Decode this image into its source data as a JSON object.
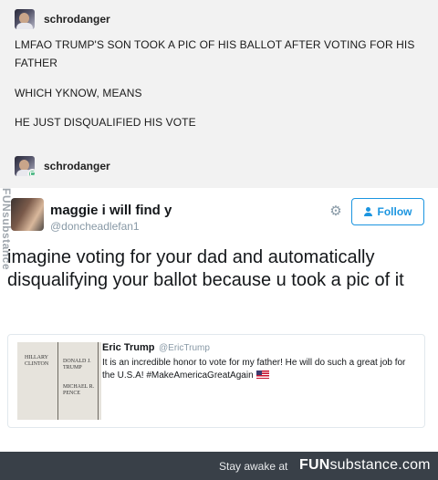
{
  "post": {
    "author": "schrodanger",
    "lines": [
      "LMFAO TRUMP'S SON TOOK A PIC OF HIS BALLOT AFTER VOTING FOR HIS",
      "FATHER",
      "WHICH YKNOW, MEANS",
      "HE JUST DISQUALIFIED HIS VOTE"
    ],
    "reblogger": "schrodanger"
  },
  "watermark": "FUNsubstance",
  "tweet": {
    "name": "maggie i will find y",
    "handle": "@doncheadlefan1",
    "settings_icon": "gear-icon",
    "follow_label": "Follow",
    "text": "imagine voting for your dad and automatically disqualifying your ballot because u took a pic of it",
    "quoted": {
      "name": "Eric Trump",
      "handle": "@EricTrump",
      "text": "It is an incredible honor to vote for my father! He will do such a great job for the U.S.A! #MakeAmericaGreatAgain",
      "thumbnail_labels": [
        "HILLARY",
        "CLINTON",
        "DONALD J.",
        "TRUMP",
        "MICHAEL R.",
        "PENCE"
      ]
    }
  },
  "footer": {
    "tagline": "Stay awake at",
    "brand_bold": "FUN",
    "brand_rest": "substance",
    "brand_suffix": ".com"
  },
  "colors": {
    "tumblr_bg": "#f2f2f2",
    "twitter_blue": "#1b95e0",
    "footer_bg": "#394048"
  }
}
